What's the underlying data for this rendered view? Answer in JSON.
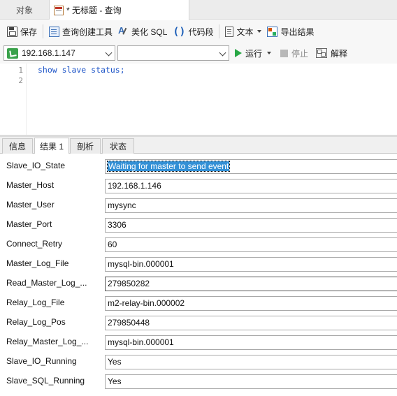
{
  "tabs": {
    "objects": "对象",
    "query": "* 无标题 - 查询"
  },
  "toolbar": {
    "save": "保存",
    "query_builder": "查询创建工具",
    "beautify_sql": "美化 SQL",
    "code_snippet": "代码段",
    "text": "文本",
    "export_result": "导出结果"
  },
  "connection": {
    "host": "192.168.1.147",
    "database": "",
    "run": "运行",
    "stop": "停止",
    "explain": "解释"
  },
  "editor": {
    "line_numbers": [
      "1",
      "2"
    ],
    "lines": [
      "show slave status;",
      ""
    ]
  },
  "result_tabs": [
    "信息",
    "结果 1",
    "剖析",
    "状态"
  ],
  "active_result_tab": "结果 1",
  "fields": [
    {
      "label": "Slave_IO_State",
      "value": "Waiting for master to send event"
    },
    {
      "label": "Master_Host",
      "value": "192.168.1.146"
    },
    {
      "label": "Master_User",
      "value": "mysync"
    },
    {
      "label": "Master_Port",
      "value": "3306"
    },
    {
      "label": "Connect_Retry",
      "value": "60"
    },
    {
      "label": "Master_Log_File",
      "value": "mysql-bin.000001"
    },
    {
      "label": "Read_Master_Log_...",
      "value": "279850282"
    },
    {
      "label": "Relay_Log_File",
      "value": "m2-relay-bin.000002"
    },
    {
      "label": "Relay_Log_Pos",
      "value": "279850448"
    },
    {
      "label": "Relay_Master_Log_...",
      "value": "mysql-bin.000001"
    },
    {
      "label": "Slave_IO_Running",
      "value": "Yes"
    },
    {
      "label": "Slave_SQL_Running",
      "value": "Yes"
    }
  ]
}
